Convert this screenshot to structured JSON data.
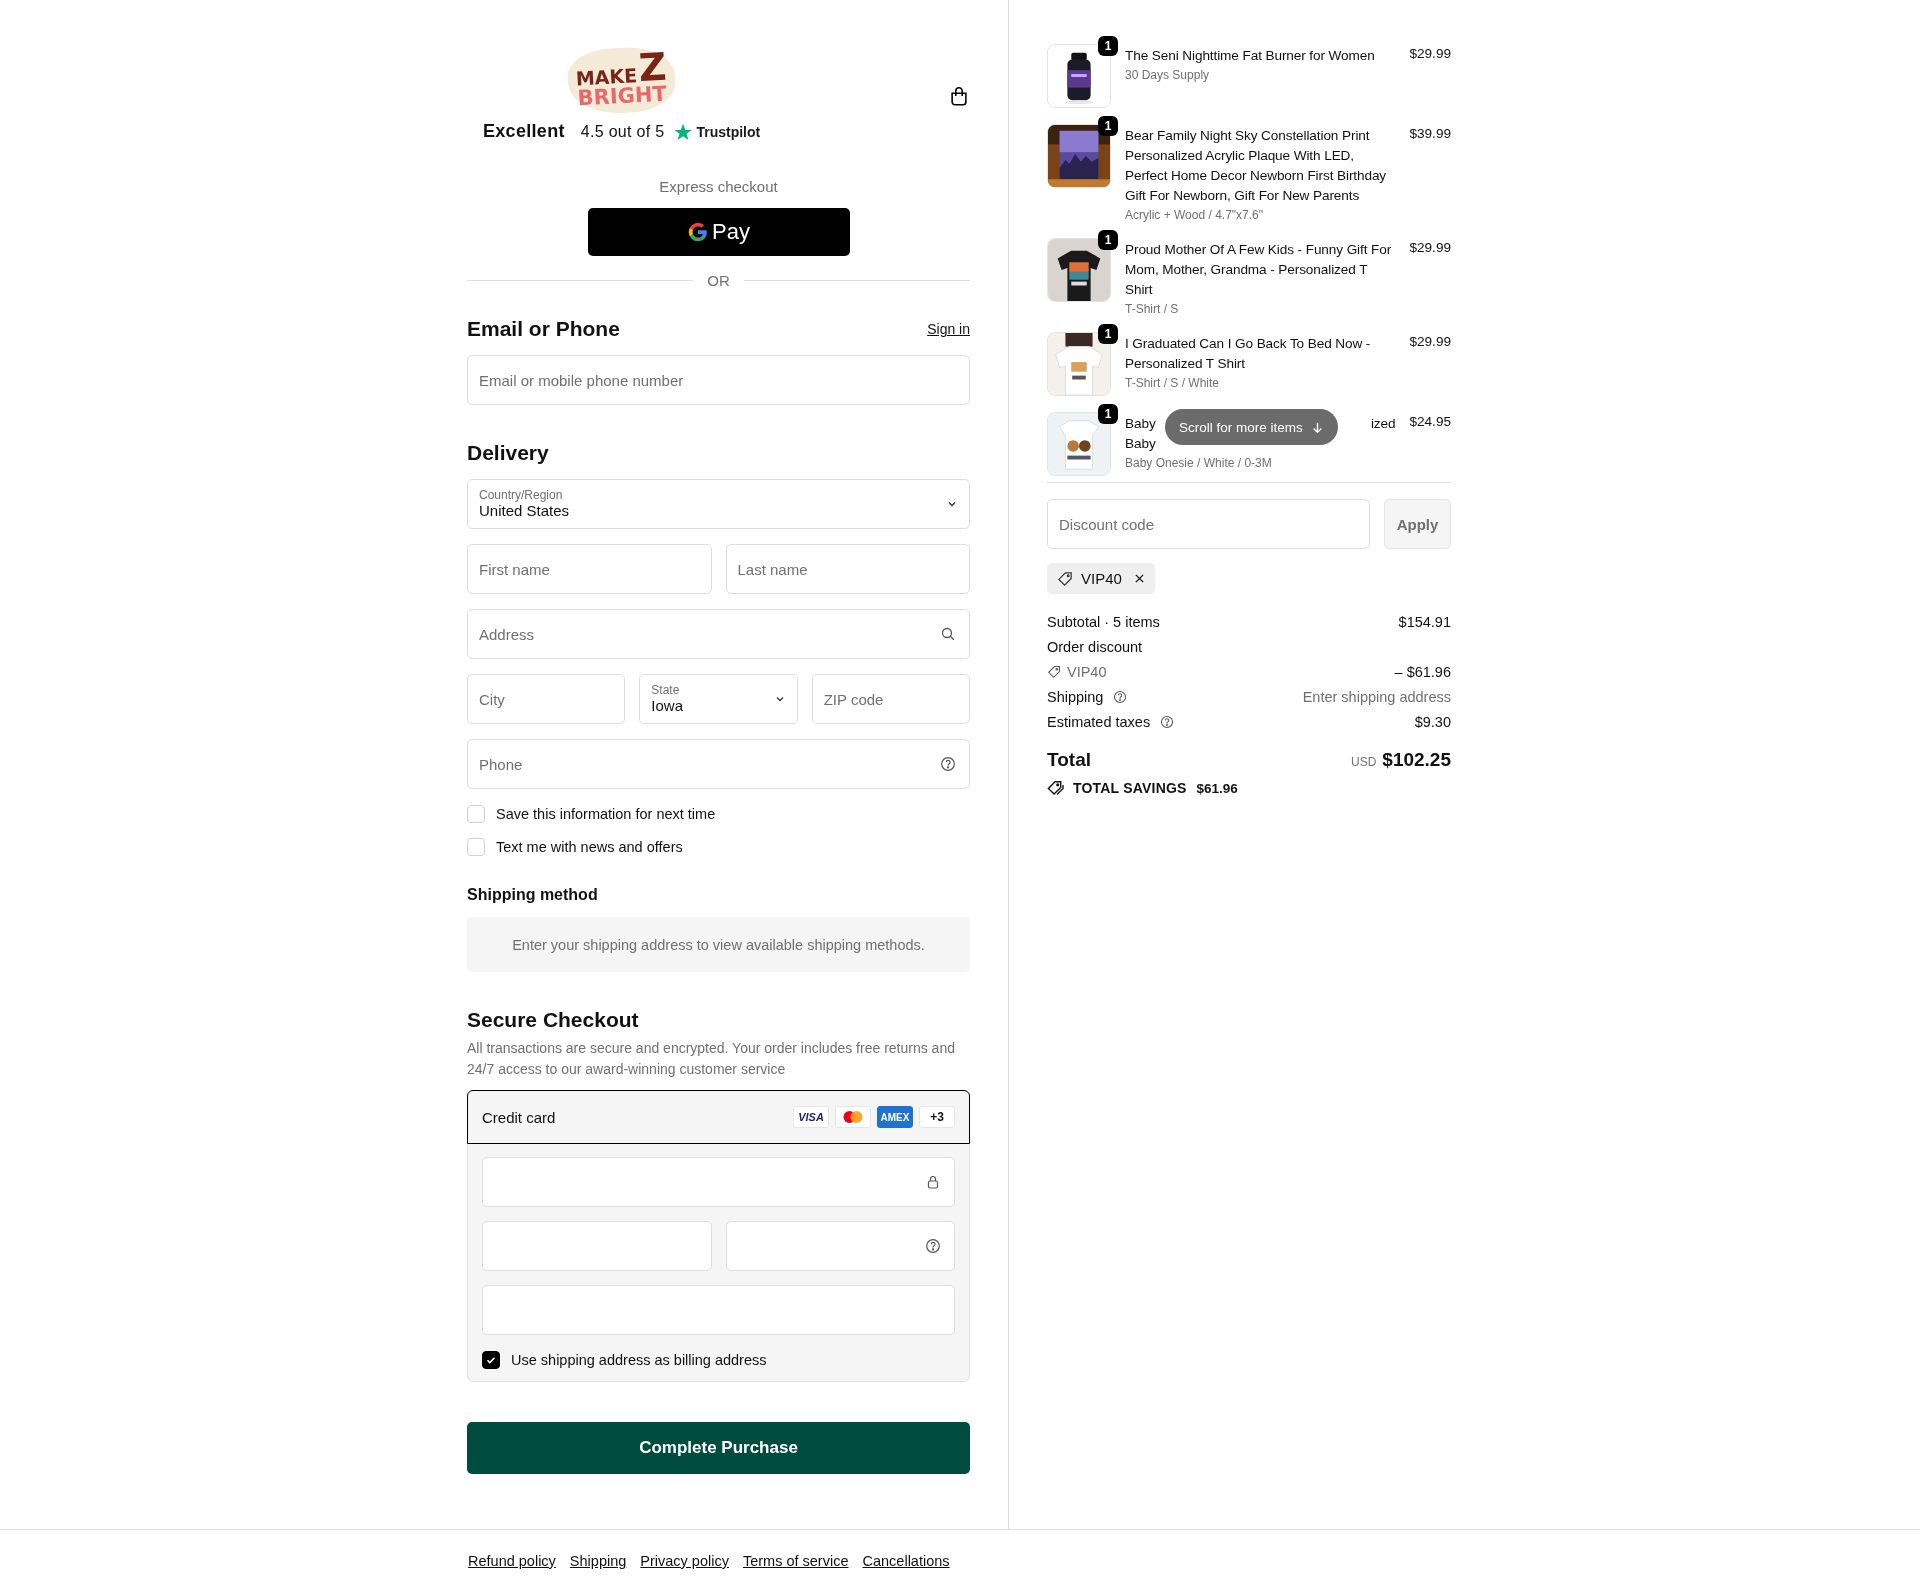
{
  "header": {
    "logo": {
      "line1": "MAKE",
      "letter": "Z",
      "line2": "BRIGHT"
    },
    "rating": {
      "label": "Excellent",
      "score": "4.5 out of 5",
      "brand": "Trustpilot"
    }
  },
  "express": {
    "label": "Express checkout",
    "button": "Pay",
    "divider": "OR"
  },
  "contact": {
    "heading": "Email or Phone",
    "link": "Sign in",
    "field": {
      "placeholder": "Email or mobile phone number"
    }
  },
  "delivery": {
    "heading": "Delivery",
    "country": {
      "label": "Country/Region",
      "value": "United States"
    },
    "first_name": {
      "placeholder": "First name"
    },
    "last_name": {
      "placeholder": "Last name"
    },
    "address": {
      "placeholder": "Address"
    },
    "city": {
      "placeholder": "City"
    },
    "state": {
      "label": "State",
      "value": "Iowa"
    },
    "zip": {
      "placeholder": "ZIP code"
    },
    "phone": {
      "placeholder": "Phone"
    },
    "options": [
      {
        "label": "Save this information for next time",
        "checked": false
      },
      {
        "label": "Text me with news and offers",
        "checked": false
      }
    ]
  },
  "shipping_method": {
    "heading": "Shipping method",
    "notice": "Enter your shipping address to view available shipping methods."
  },
  "payment": {
    "heading": "Secure Checkout",
    "note": "All transactions are secure and encrypted. Your order includes free returns and 24/7 access to our award-winning customer service",
    "method": {
      "label": "Credit card",
      "selected": true
    },
    "brands": [
      {
        "kind": "visa",
        "label": "VISA"
      },
      {
        "kind": "mastercard"
      },
      {
        "kind": "amex",
        "label": "AMEX"
      },
      {
        "kind": "more",
        "label": "+3"
      }
    ],
    "billing": {
      "label": "Use shipping address as billing address",
      "checked": true
    }
  },
  "submit": "Complete Purchase",
  "footer_links": [
    "Refund policy",
    "Shipping",
    "Privacy policy",
    "Terms of service",
    "Cancellations"
  ],
  "cart": {
    "items": [
      {
        "quantity": "1",
        "title": "The Seni Nighttime Fat Burner for Women",
        "variant": "30 Days Supply",
        "price": "$29.99"
      },
      {
        "quantity": "1",
        "title": "Bear Family Night Sky Constellation Print Personalized Acrylic Plaque With LED, Perfect Home Decor Newborn First Birthday Gift For Newborn, Gift For New Parents",
        "variant": "Acrylic + Wood / 4.7\"x7.6\"",
        "price": "$39.99"
      },
      {
        "quantity": "1",
        "title": "Proud Mother Of A Few Kids - Funny Gift For Mom, Mother, Grandma - Personalized T Shirt",
        "variant": "T-Shirt / S",
        "price": "$29.99"
      },
      {
        "quantity": "1",
        "title": "I Graduated Can I Go Back To Bed Now - Personalized T Shirt",
        "variant": "T-Shirt / S / White",
        "price": "$29.99"
      },
      {
        "quantity": "1",
        "title_fragments": [
          [
            "Baby",
            "ized"
          ],
          [
            "Baby"
          ]
        ],
        "variant": "Baby Onesie / White / 0-3M",
        "price": "$24.95"
      }
    ],
    "scroll_hint": "Scroll for more items"
  },
  "discount": {
    "field": {
      "placeholder": "Discount code"
    },
    "button": "Apply",
    "applied": "VIP40"
  },
  "summary": {
    "subtotal": {
      "label": "Subtotal · 5 items",
      "value": "$154.91"
    },
    "order_discount": {
      "label": "Order discount",
      "code": "VIP40",
      "value": "– $61.96"
    },
    "shipping": {
      "label": "Shipping",
      "value": "Enter shipping address"
    },
    "taxes": {
      "label": "Estimated taxes",
      "value": "$9.30"
    },
    "total": {
      "label": "Total",
      "currency": "USD",
      "value": "$102.25"
    },
    "savings": {
      "label": "TOTAL SAVINGS",
      "value": "$61.96"
    }
  }
}
